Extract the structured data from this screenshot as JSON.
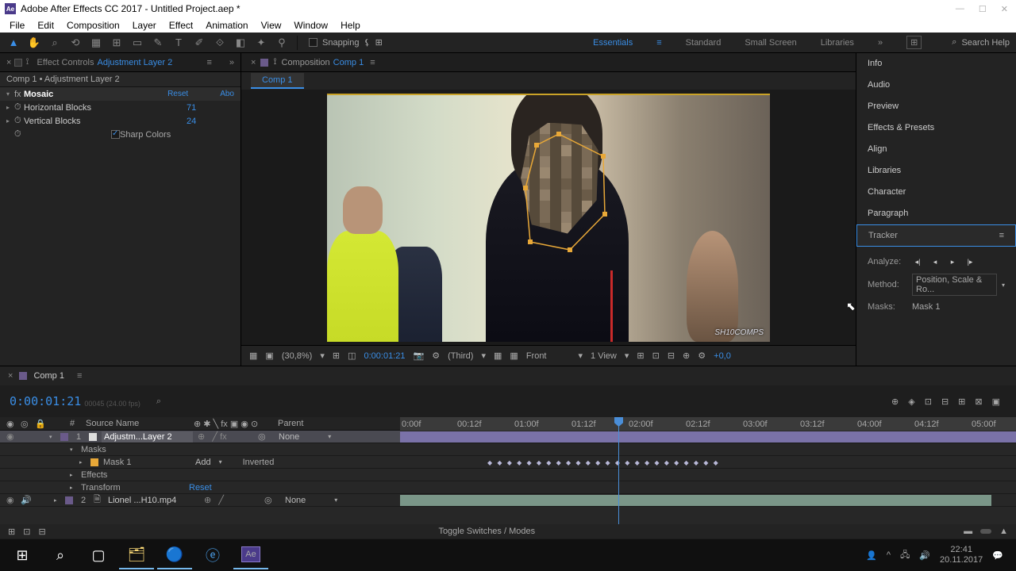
{
  "titlebar": {
    "app": "Ae",
    "title": "Adobe After Effects CC 2017 - Untitled Project.aep *"
  },
  "menubar": [
    "File",
    "Edit",
    "Composition",
    "Layer",
    "Effect",
    "Animation",
    "View",
    "Window",
    "Help"
  ],
  "toolbar": {
    "snapping": "Snapping",
    "workspaces": [
      "Essentials",
      "Standard",
      "Small Screen",
      "Libraries"
    ],
    "active_ws": 0,
    "search_placeholder": "Search Help"
  },
  "effectControls": {
    "tab": "Effect Controls",
    "tabSub": "Adjustment Layer 2",
    "crumb": "Comp 1 • Adjustment Layer 2",
    "effect": "Mosaic",
    "reset": "Reset",
    "abo": "Abo",
    "props": {
      "hb_label": "Horizontal Blocks",
      "hb_val": "71",
      "vb_label": "Vertical Blocks",
      "vb_val": "24",
      "sharp": "Sharp Colors"
    }
  },
  "compPanel": {
    "tab": "Composition",
    "tabSub": "Comp 1",
    "subtab": "Comp 1",
    "watermark": "SH10COMPS"
  },
  "viewerControls": {
    "zoom": "(30,8%)",
    "time": "0:00:01:21",
    "res": "(Third)",
    "cam": "Front",
    "views": "1 View",
    "exp": "+0,0"
  },
  "rightPanels": [
    "Info",
    "Audio",
    "Preview",
    "Effects & Presets",
    "Align",
    "Libraries",
    "Character",
    "Paragraph",
    "Tracker"
  ],
  "tracker": {
    "analyze": "Analyze:",
    "method_lbl": "Method:",
    "method_val": "Position, Scale & Ro...",
    "masks_lbl": "Masks:",
    "masks_val": "Mask 1"
  },
  "timeline": {
    "tab": "Comp 1",
    "timecode": "0:00:01:21",
    "fps": "00045 (24.00 fps)",
    "cols": {
      "num": "#",
      "name": "Source Name",
      "parent": "Parent"
    },
    "layer1": {
      "num": "1",
      "name": "Adjustm...Layer 2",
      "parent": "None"
    },
    "masks": "Masks",
    "mask1": {
      "name": "Mask 1",
      "mode": "Add",
      "inv": "Inverted"
    },
    "effects": "Effects",
    "transform": "Transform",
    "reset": "Reset",
    "layer2": {
      "num": "2",
      "name": "Lionel ...H10.mp4",
      "parent": "None"
    },
    "ruler": [
      "0:00f",
      "00:12f",
      "01:00f",
      "01:12f",
      "02:00f",
      "02:12f",
      "03:00f",
      "03:12f",
      "04:00f",
      "04:12f",
      "05:00f"
    ],
    "switches": "Toggle Switches / Modes"
  },
  "taskbar": {
    "time": "22:41",
    "date": "20.11.2017"
  }
}
